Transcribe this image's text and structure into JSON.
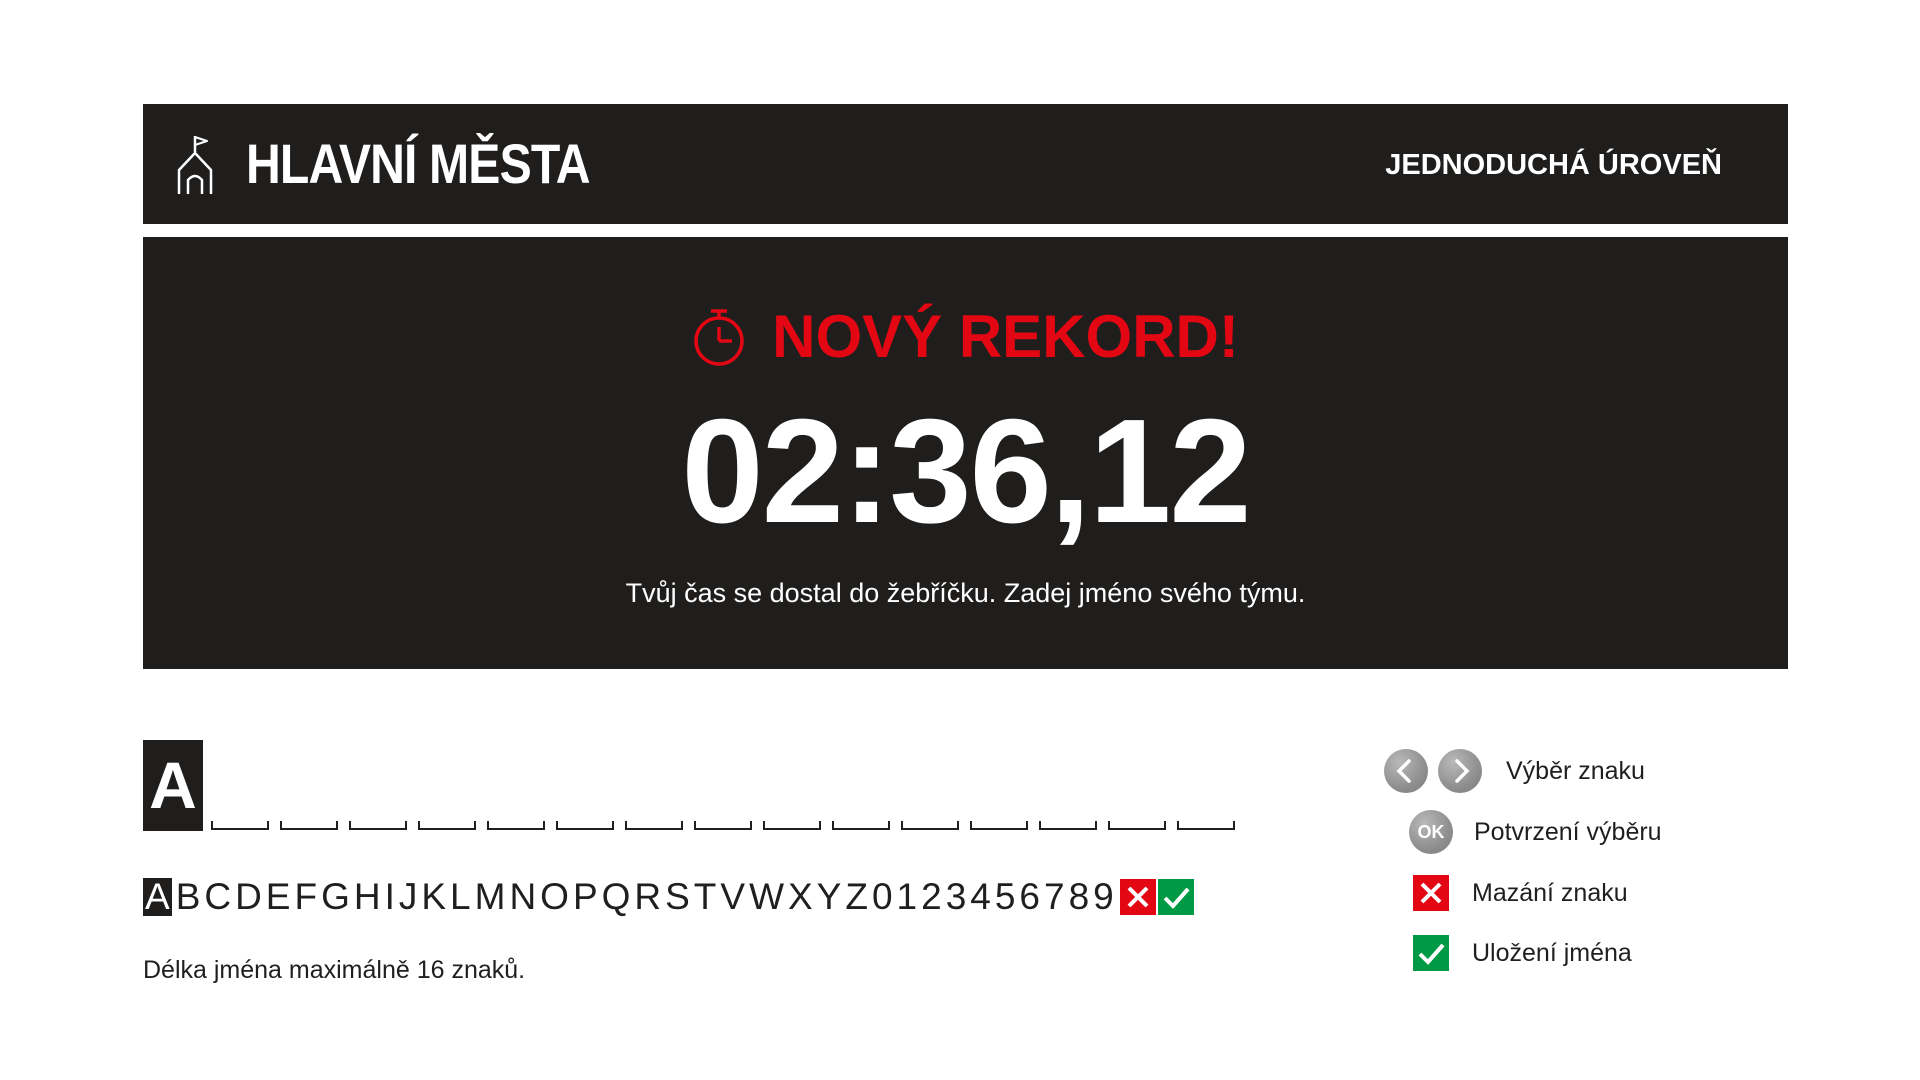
{
  "header": {
    "app_icon": "flag-house-icon",
    "title": "HLAVNÍ MĚSTA",
    "level": "JEDNODUCHÁ ÚROVEŇ"
  },
  "record": {
    "icon": "stopwatch-icon",
    "title": "NOVÝ REKORD!",
    "time": "02:36,12",
    "message": "Tvůj čas se dostal do žebříčku. Zadej jméno svého týmu."
  },
  "name_entry": {
    "current_char": "A",
    "slots": 15,
    "alphabet_selected": "A",
    "alphabet_rest": "BCDEFGHIJKLMNOPQRSTVWXYZ0123456789",
    "delete_key_icon": "red-x-icon",
    "save_key_icon": "green-check-icon",
    "hint": "Délka jména maximálně 16  znaků."
  },
  "legend": {
    "select_char": "Výběr znaku",
    "confirm_ok_text": "OK",
    "confirm": "Potvrzení výběru",
    "delete": "Mazání znaku",
    "save": "Uložení jména"
  },
  "colors": {
    "dark": "#1f1e1d",
    "accent_red": "#e30613",
    "accent_green": "#009a44",
    "button_gray": "#8f8f8f"
  }
}
